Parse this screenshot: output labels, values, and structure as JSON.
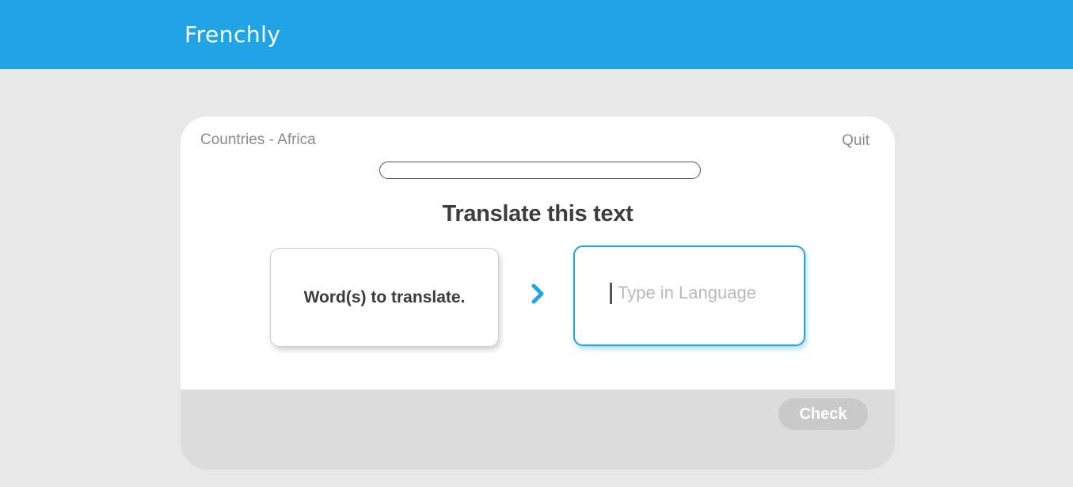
{
  "app": {
    "title": "Frenchly"
  },
  "lesson": {
    "name": "Countries - Africa",
    "quit_label": "Quit",
    "progress": 0
  },
  "exercise": {
    "prompt": "Translate this text",
    "source_text": "Word(s) to translate.",
    "answer_value": "",
    "answer_placeholder": "Type in Language"
  },
  "footer": {
    "check_label": "Check"
  },
  "colors": {
    "accent": "#21a4e5",
    "background": "#e8e8e8",
    "footer": "#dcdcdc",
    "check_disabled": "#c9c9c9"
  },
  "icons": {
    "arrow": "chevron-right-icon"
  }
}
